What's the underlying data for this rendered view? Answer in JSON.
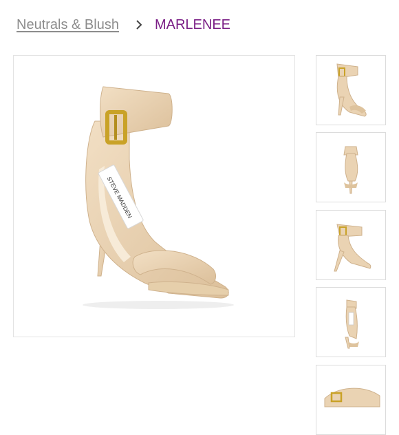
{
  "breadcrumb": {
    "parent_label": "Neutrals & Blush",
    "separator": "chevron-right-icon",
    "current_label": "MARLENEE"
  },
  "product": {
    "brand_on_insole": "STEVE MADDEN",
    "colors": {
      "shoe": "#ead3b3",
      "buckle": "#c9a227",
      "current_crumb": "#7b1f86",
      "link": "#8c8c8c"
    }
  },
  "gallery": {
    "thumbnails": [
      {
        "name": "front-three-quarter-view"
      },
      {
        "name": "back-view"
      },
      {
        "name": "side-view"
      },
      {
        "name": "inner-side-view"
      },
      {
        "name": "top-view"
      }
    ]
  }
}
